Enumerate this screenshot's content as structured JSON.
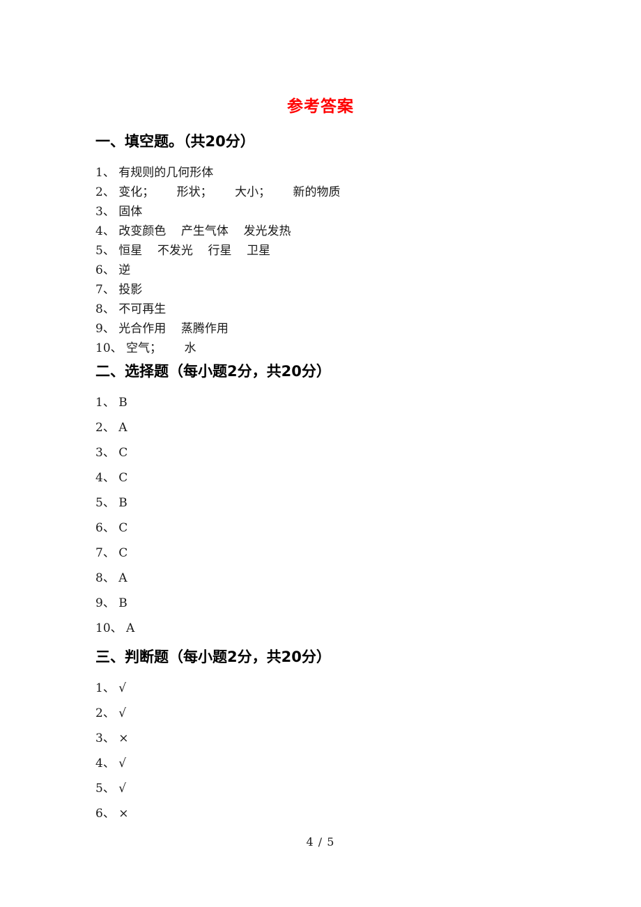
{
  "document": {
    "title": "参考答案",
    "title_color": "#ff0000",
    "footer": "4 / 5"
  },
  "sections": [
    {
      "heading": "一、填空题。（共20分）",
      "items": [
        {
          "num": "1、",
          "value": "有规则的几何形体"
        },
        {
          "num": "2、",
          "value": "变化；      形状；      大小；      新的物质"
        },
        {
          "num": "3、",
          "value": "固体"
        },
        {
          "num": "4、",
          "value": "改变颜色    产生气体    发光发热"
        },
        {
          "num": "5、",
          "value": "恒星    不发光    行星    卫星"
        },
        {
          "num": "6、",
          "value": "逆"
        },
        {
          "num": "7、",
          "value": "投影"
        },
        {
          "num": "8、",
          "value": "不可再生"
        },
        {
          "num": "9、",
          "value": "光合作用    蒸腾作用"
        },
        {
          "num": "10、",
          "value": "空气；      水"
        }
      ]
    },
    {
      "heading": "二、选择题（每小题2分，共20分）",
      "items": [
        {
          "num": "1、",
          "value": "B"
        },
        {
          "num": "2、",
          "value": "A"
        },
        {
          "num": "3、",
          "value": "C"
        },
        {
          "num": "4、",
          "value": "C"
        },
        {
          "num": "5、",
          "value": "B"
        },
        {
          "num": "6、",
          "value": "C"
        },
        {
          "num": "7、",
          "value": "C"
        },
        {
          "num": "8、",
          "value": "A"
        },
        {
          "num": "9、",
          "value": "B"
        },
        {
          "num": "10、",
          "value": "A"
        }
      ]
    },
    {
      "heading": "三、判断题（每小题2分，共20分）",
      "items": [
        {
          "num": "1、",
          "value": "√"
        },
        {
          "num": "2、",
          "value": "√"
        },
        {
          "num": "3、",
          "value": "×"
        },
        {
          "num": "4、",
          "value": "√"
        },
        {
          "num": "5、",
          "value": "√"
        },
        {
          "num": "6、",
          "value": "×"
        }
      ]
    }
  ]
}
